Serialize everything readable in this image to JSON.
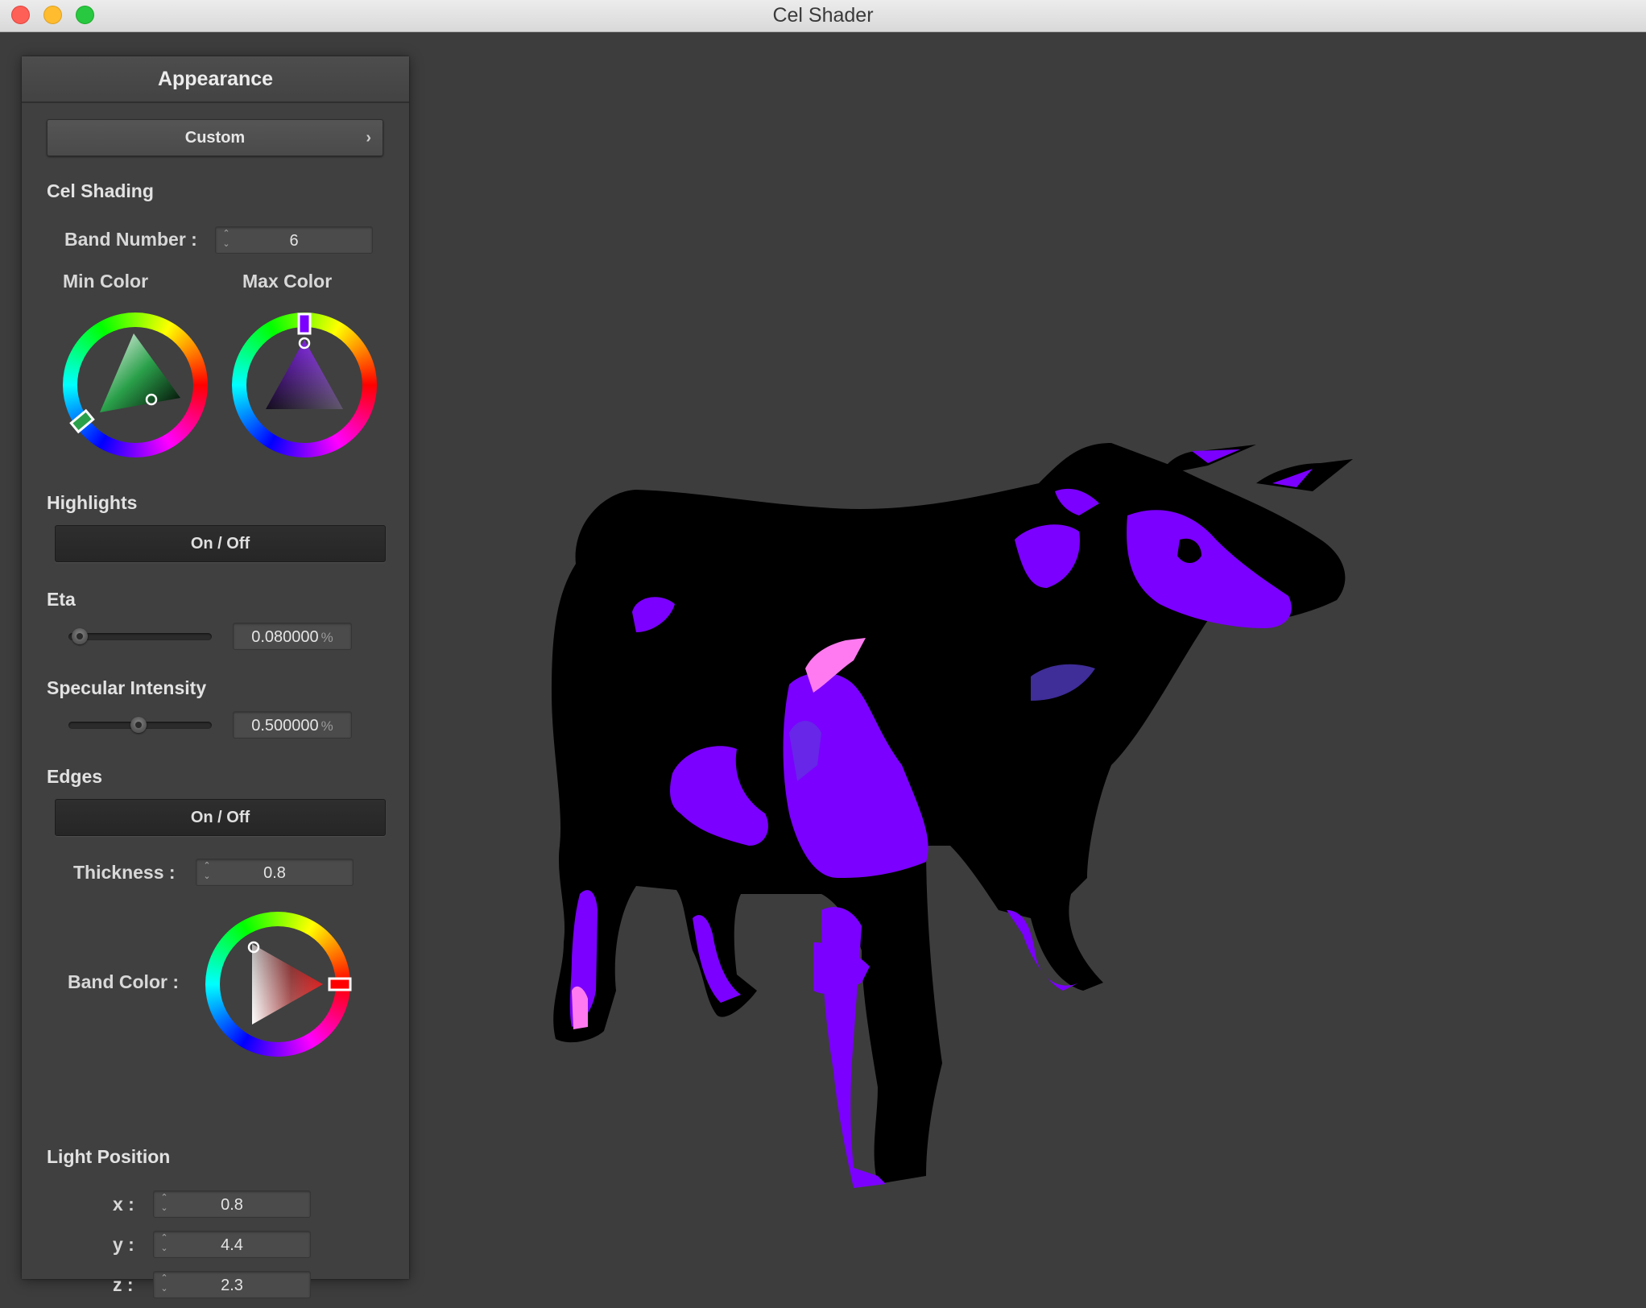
{
  "window": {
    "title": "Cel Shader"
  },
  "panel": {
    "header": "Appearance",
    "preset": {
      "label": "Custom",
      "chevron": "›"
    },
    "cel_shading": {
      "title": "Cel Shading",
      "band_number_label": "Band Number :",
      "band_number_value": "6",
      "min_color_label": "Min Color",
      "max_color_label": "Max Color",
      "min_color": "#1e6e3a",
      "max_color": "#7b00ff"
    },
    "highlights": {
      "title": "Highlights",
      "toggle_label": "On / Off"
    },
    "eta": {
      "title": "Eta",
      "value": "0.080000",
      "unit": "%",
      "slider_fraction": 0.0
    },
    "specular": {
      "title": "Specular Intensity",
      "value": "0.500000",
      "unit": "%",
      "slider_fraction": 0.5
    },
    "edges": {
      "title": "Edges",
      "toggle_label": "On / Off",
      "thickness_label": "Thickness :",
      "thickness_value": "0.8",
      "band_color_label": "Band Color :",
      "band_color": "#ff0000"
    },
    "light_position": {
      "title": "Light Position",
      "x_label": "x :",
      "x_value": "0.8",
      "y_label": "y :",
      "y_value": "4.4",
      "z_label": "z :",
      "z_value": "2.3"
    }
  },
  "icons": {
    "spinner_arrows": "up-down-chevron-icon",
    "color_wheel": "color-wheel-icon"
  },
  "viewport": {
    "model_colors": {
      "outline": "#000000",
      "fill": "#7b00ff",
      "highlight": "#ff7af0",
      "mid": "#5a40d8"
    }
  }
}
